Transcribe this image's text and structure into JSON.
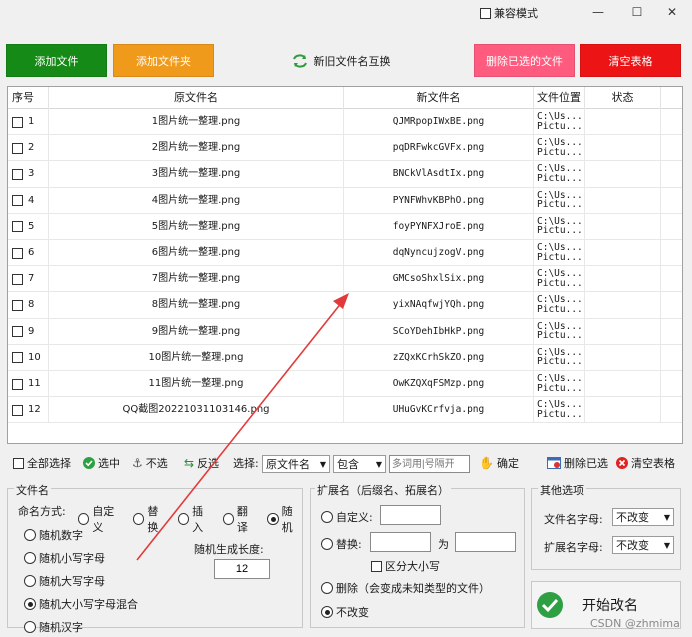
{
  "titlebar": {
    "compat_label": "兼容模式",
    "minimize": "—",
    "maximize": "☐",
    "close": "✕"
  },
  "toolbar": {
    "add_file": "添加文件",
    "add_folder": "添加文件夹",
    "swap_names": "新旧文件名互换",
    "delete_selected": "删除已选的文件",
    "clear_table": "清空表格"
  },
  "colors": {
    "add_file": "#168a16",
    "add_folder": "#f09a1c",
    "delete_selected": "#ff5b7f",
    "clear_table": "#ec1414",
    "arrow": "#e23a3a"
  },
  "table": {
    "headers": [
      "序号",
      "原文件名",
      "新文件名",
      "文件位置",
      "状态"
    ],
    "rows": [
      {
        "index": "1",
        "orig": "1图片统一整理.png",
        "new": "QJMRpopIWxBE.png",
        "loc": "C:\\Us...\nPictu...",
        "status": ""
      },
      {
        "index": "2",
        "orig": "2图片统一整理.png",
        "new": "pqDRFwkcGVFx.png",
        "loc": "C:\\Us...\nPictu...",
        "status": ""
      },
      {
        "index": "3",
        "orig": "3图片统一整理.png",
        "new": "BNCkVlAsdtIx.png",
        "loc": "C:\\Us...\nPictu...",
        "status": ""
      },
      {
        "index": "4",
        "orig": "4图片统一整理.png",
        "new": "PYNFWhvKBPhO.png",
        "loc": "C:\\Us...\nPictu...",
        "status": ""
      },
      {
        "index": "5",
        "orig": "5图片统一整理.png",
        "new": "foyPYNFXJroE.png",
        "loc": "C:\\Us...\nPictu...",
        "status": ""
      },
      {
        "index": "6",
        "orig": "6图片统一整理.png",
        "new": "dqNyncujzogV.png",
        "loc": "C:\\Us...\nPictu...",
        "status": ""
      },
      {
        "index": "7",
        "orig": "7图片统一整理.png",
        "new": "GMCsoShxlSix.png",
        "loc": "C:\\Us...\nPictu...",
        "status": ""
      },
      {
        "index": "8",
        "orig": "8图片统一整理.png",
        "new": "yixNAqfwjYQh.png",
        "loc": "C:\\Us...\nPictu...",
        "status": ""
      },
      {
        "index": "9",
        "orig": "9图片统一整理.png",
        "new": "SCoYDehIbHkP.png",
        "loc": "C:\\Us...\nPictu...",
        "status": ""
      },
      {
        "index": "10",
        "orig": "10图片统一整理.png",
        "new": "zZQxKCrhSkZO.png",
        "loc": "C:\\Us...\nPictu...",
        "status": ""
      },
      {
        "index": "11",
        "orig": "11图片统一整理.png",
        "new": "OwKZQXqFSMzp.png",
        "loc": "C:\\Us...\nPictu...",
        "status": ""
      },
      {
        "index": "12",
        "orig": "QQ截图20221031103146.png",
        "new": "UHuGvKCrfvja.png",
        "loc": "C:\\Us...\nPictu...",
        "status": ""
      }
    ]
  },
  "selection_bar": {
    "select_all": "全部选择",
    "select_checked": "选中",
    "unselect": "不选",
    "invert": "反选",
    "choose_label": "选择:",
    "field_value": "原文件名",
    "match_value": "包含",
    "keyword_placeholder": "多词用|号隔开",
    "confirm": "确定",
    "delete_checked": "删除已选",
    "clear_table": "清空表格"
  },
  "filename_group": {
    "title": "文件名",
    "mode_label": "命名方式:",
    "modes": [
      "自定义",
      "替换",
      "插入",
      "翻译",
      "随机"
    ],
    "selected_mode": "随机",
    "random_types": [
      "随机数字",
      "随机小写字母",
      "随机大写字母",
      "随机大小写字母混合",
      "随机汉字"
    ],
    "selected_random_type": "随机大小写字母混合",
    "length_label": "随机生成长度:",
    "length_value": "12"
  },
  "ext_group": {
    "title": "扩展名（后缀名、拓展名）",
    "custom_label": "自定义:",
    "replace_label": "替换:",
    "to_label": "为",
    "case_label": "区分大小写",
    "delete_label": "删除（会变成未知类型的文件）",
    "unchanged_label": "不改变",
    "selected": "不改变"
  },
  "other_group": {
    "title": "其他选项",
    "filename_case_label": "文件名字母:",
    "filename_case_value": "不改变",
    "ext_case_label": "扩展名字母:",
    "ext_case_value": "不改变"
  },
  "start": {
    "label": "开始改名"
  },
  "watermark": "CSDN @zhmima"
}
